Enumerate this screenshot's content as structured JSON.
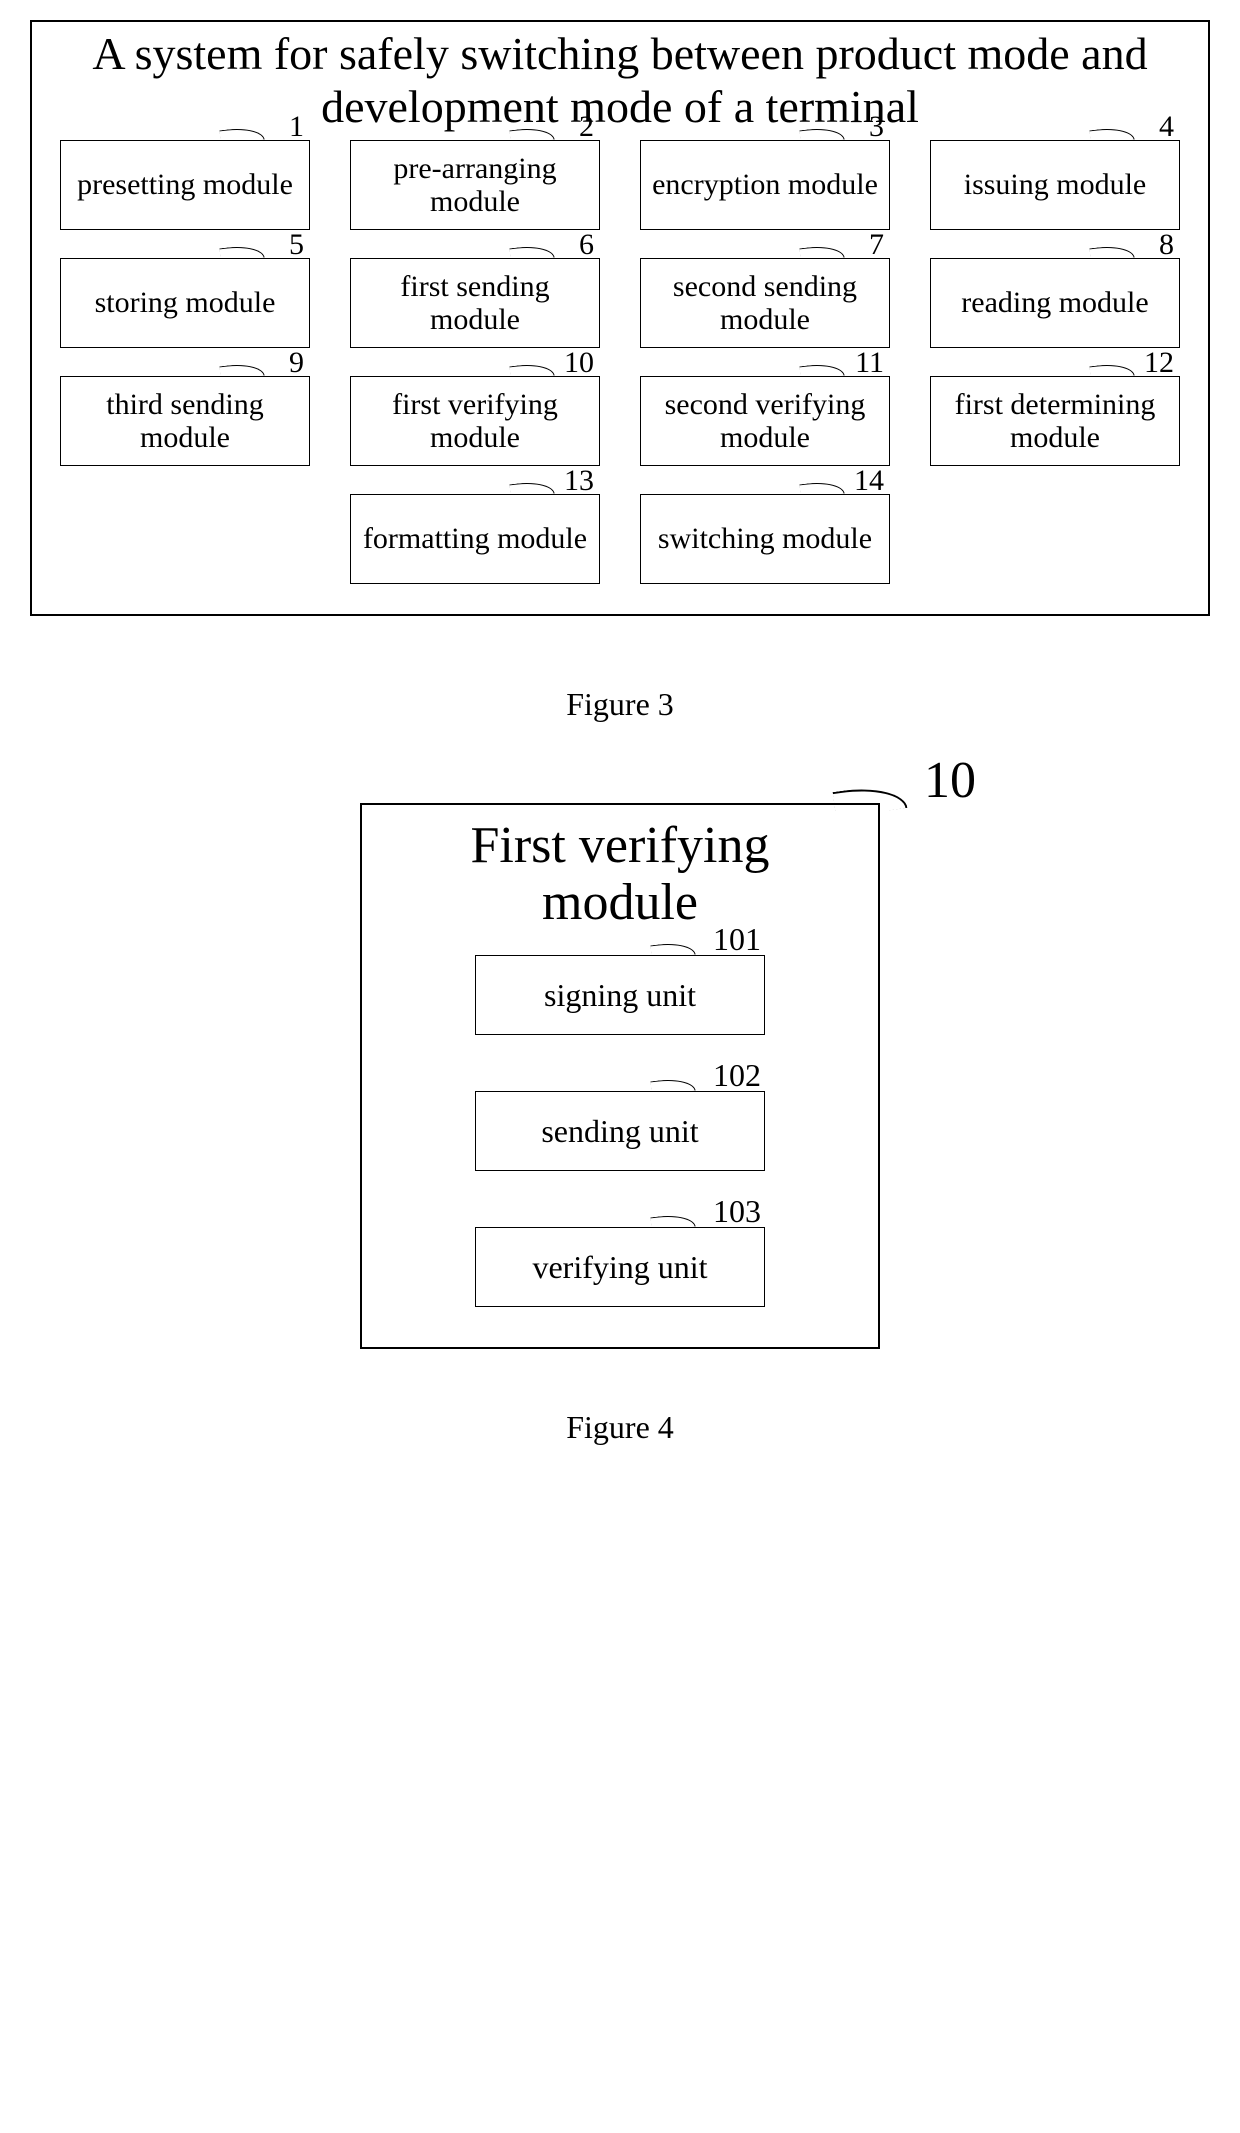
{
  "figure3": {
    "title": "A system for safely switching between product mode and development mode of a terminal",
    "caption": "Figure 3",
    "modules": [
      {
        "ref": "1",
        "label": "presetting module"
      },
      {
        "ref": "2",
        "label": "pre-arranging module"
      },
      {
        "ref": "3",
        "label": "encryption module"
      },
      {
        "ref": "4",
        "label": "issuing module"
      },
      {
        "ref": "5",
        "label": "storing module"
      },
      {
        "ref": "6",
        "label": "first sending module"
      },
      {
        "ref": "7",
        "label": "second sending module"
      },
      {
        "ref": "8",
        "label": "reading module"
      },
      {
        "ref": "9",
        "label": "third sending module"
      },
      {
        "ref": "10",
        "label": "first verifying module"
      },
      {
        "ref": "11",
        "label": "second verifying module"
      },
      {
        "ref": "12",
        "label": "first determining module"
      },
      {
        "ref": "13",
        "label": "formatting module"
      },
      {
        "ref": "14",
        "label": "switching module"
      }
    ]
  },
  "figure4": {
    "ref": "10",
    "title": "First verifying module",
    "title_sub_ref": "101",
    "caption": "Figure 4",
    "units": [
      {
        "ref": "101",
        "label": "signing unit"
      },
      {
        "ref": "102",
        "label": "sending unit"
      },
      {
        "ref": "103",
        "label": "verifying unit"
      }
    ]
  }
}
